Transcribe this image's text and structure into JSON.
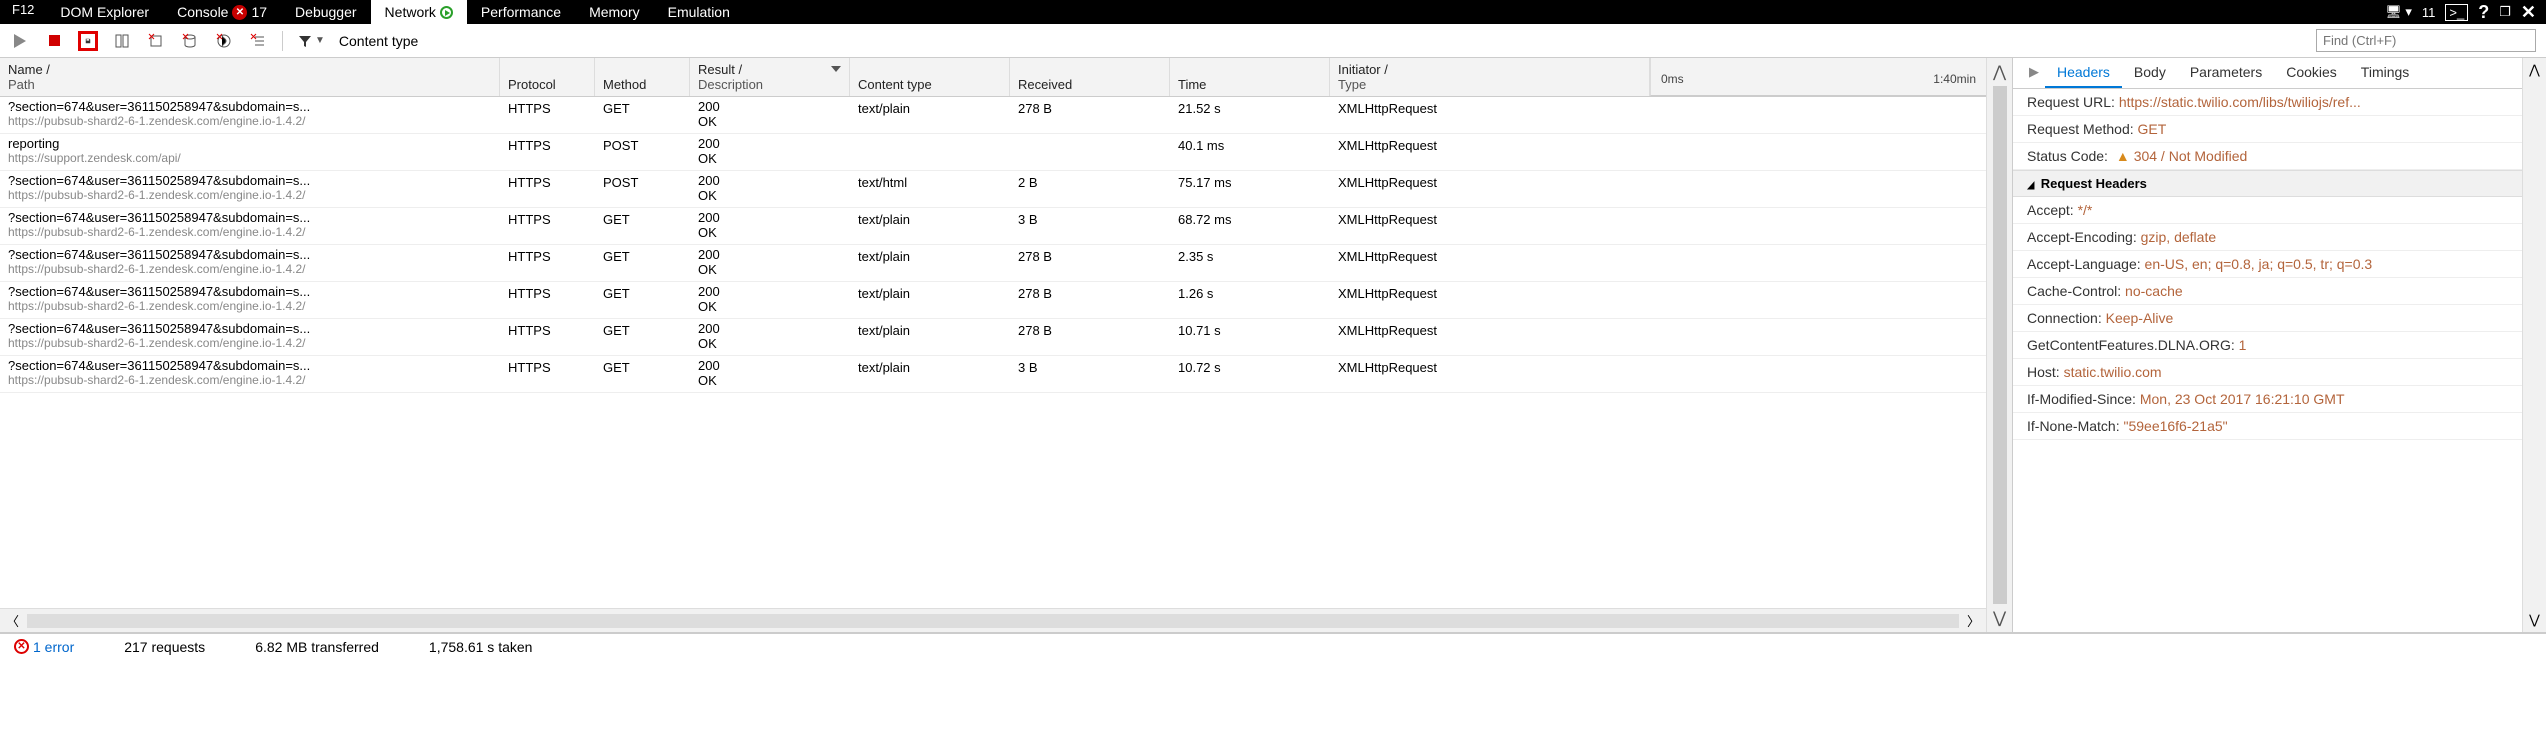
{
  "topbar": {
    "f12": "F12",
    "tabs": [
      "DOM Explorer",
      "Console",
      "Debugger",
      "Network",
      "Performance",
      "Memory",
      "Emulation"
    ],
    "console_err_count": "17",
    "device_count": "11"
  },
  "toolbar": {
    "content_type_label": "Content type",
    "find_placeholder": "Find (Ctrl+F)"
  },
  "grid": {
    "headers": {
      "name": "Name /",
      "name2": "Path",
      "protocol": "Protocol",
      "method": "Method",
      "result": "Result /",
      "result2": "Description",
      "content_type": "Content type",
      "received": "Received",
      "time": "Time",
      "initiator": "Initiator /",
      "initiator2": "Type"
    },
    "timeline": {
      "start": "0ms",
      "end": "1:40min"
    },
    "rows": [
      {
        "name": "?section=674&user=361150258947&subdomain=s...",
        "path": "https://pubsub-shard2-6-1.zendesk.com/engine.io-1.4.2/",
        "protocol": "HTTPS",
        "method": "GET",
        "result": "200",
        "desc": "OK",
        "ctype": "text/plain",
        "recv": "278 B",
        "time": "21.52 s",
        "initiator": "XMLHttpRequest"
      },
      {
        "name": "reporting",
        "path": "https://support.zendesk.com/api/",
        "protocol": "HTTPS",
        "method": "POST",
        "result": "200",
        "desc": "OK",
        "ctype": "",
        "recv": "",
        "time": "40.1 ms",
        "initiator": "XMLHttpRequest"
      },
      {
        "name": "?section=674&user=361150258947&subdomain=s...",
        "path": "https://pubsub-shard2-6-1.zendesk.com/engine.io-1.4.2/",
        "protocol": "HTTPS",
        "method": "POST",
        "result": "200",
        "desc": "OK",
        "ctype": "text/html",
        "recv": "2 B",
        "time": "75.17 ms",
        "initiator": "XMLHttpRequest"
      },
      {
        "name": "?section=674&user=361150258947&subdomain=s...",
        "path": "https://pubsub-shard2-6-1.zendesk.com/engine.io-1.4.2/",
        "protocol": "HTTPS",
        "method": "GET",
        "result": "200",
        "desc": "OK",
        "ctype": "text/plain",
        "recv": "3 B",
        "time": "68.72 ms",
        "initiator": "XMLHttpRequest"
      },
      {
        "name": "?section=674&user=361150258947&subdomain=s...",
        "path": "https://pubsub-shard2-6-1.zendesk.com/engine.io-1.4.2/",
        "protocol": "HTTPS",
        "method": "GET",
        "result": "200",
        "desc": "OK",
        "ctype": "text/plain",
        "recv": "278 B",
        "time": "2.35 s",
        "initiator": "XMLHttpRequest"
      },
      {
        "name": "?section=674&user=361150258947&subdomain=s...",
        "path": "https://pubsub-shard2-6-1.zendesk.com/engine.io-1.4.2/",
        "protocol": "HTTPS",
        "method": "GET",
        "result": "200",
        "desc": "OK",
        "ctype": "text/plain",
        "recv": "278 B",
        "time": "1.26 s",
        "initiator": "XMLHttpRequest"
      },
      {
        "name": "?section=674&user=361150258947&subdomain=s...",
        "path": "https://pubsub-shard2-6-1.zendesk.com/engine.io-1.4.2/",
        "protocol": "HTTPS",
        "method": "GET",
        "result": "200",
        "desc": "OK",
        "ctype": "text/plain",
        "recv": "278 B",
        "time": "10.71 s",
        "initiator": "XMLHttpRequest"
      },
      {
        "name": "?section=674&user=361150258947&subdomain=s...",
        "path": "https://pubsub-shard2-6-1.zendesk.com/engine.io-1.4.2/",
        "protocol": "HTTPS",
        "method": "GET",
        "result": "200",
        "desc": "OK",
        "ctype": "text/plain",
        "recv": "3 B",
        "time": "10.72 s",
        "initiator": "XMLHttpRequest"
      }
    ]
  },
  "side": {
    "tabs": [
      "Headers",
      "Body",
      "Parameters",
      "Cookies",
      "Timings"
    ],
    "summary": {
      "url_key": "Request URL: ",
      "url_val": "https://static.twilio.com/libs/twiliojs/ref...",
      "method_key": "Request Method: ",
      "method_val": "GET",
      "status_key": "Status Code: ",
      "status_val": "304 / Not Modified"
    },
    "req_headers_title": "Request Headers",
    "headers_list": [
      {
        "k": "Accept: ",
        "v": "*/*"
      },
      {
        "k": "Accept-Encoding: ",
        "v": "gzip, deflate"
      },
      {
        "k": "Accept-Language: ",
        "v": "en-US, en; q=0.8, ja; q=0.5, tr; q=0.3"
      },
      {
        "k": "Cache-Control: ",
        "v": "no-cache"
      },
      {
        "k": "Connection: ",
        "v": "Keep-Alive"
      },
      {
        "k": "GetContentFeatures.DLNA.ORG: ",
        "v": "1"
      },
      {
        "k": "Host: ",
        "v": "static.twilio.com"
      },
      {
        "k": "If-Modified-Since: ",
        "v": "Mon, 23 Oct 2017 16:21:10 GMT"
      },
      {
        "k": "If-None-Match: ",
        "v": "\"59ee16f6-21a5\""
      }
    ]
  },
  "status": {
    "errors": "1 error",
    "requests": "217 requests",
    "transferred": "6.82 MB transferred",
    "taken": "1,758.61 s taken"
  }
}
